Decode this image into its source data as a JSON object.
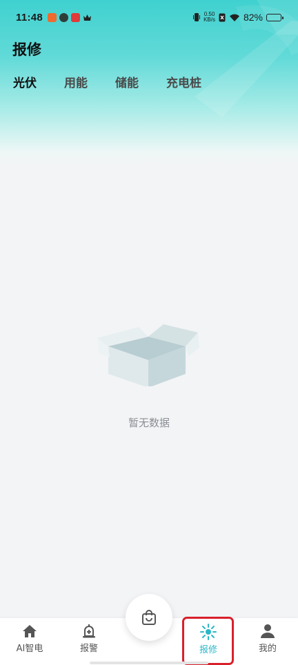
{
  "status_bar": {
    "time": "11:48",
    "net_speed_value": "0.50",
    "net_speed_unit": "KB/s",
    "battery_percent": "82%",
    "battery_level": 0.82
  },
  "page": {
    "title": "报修"
  },
  "tabs": [
    {
      "label": "光伏",
      "active": true
    },
    {
      "label": "用能",
      "active": false
    },
    {
      "label": "储能",
      "active": false
    },
    {
      "label": "充电桩",
      "active": false
    }
  ],
  "empty_state": {
    "text": "暂无数据",
    "icon": "empty-box-icon"
  },
  "bottom_nav": {
    "items": [
      {
        "label": "AI智电",
        "icon": "home-icon"
      },
      {
        "label": "报警",
        "icon": "alarm-bell-icon"
      },
      {
        "label": "报修",
        "icon": "repair-icon",
        "active": true
      },
      {
        "label": "我的",
        "icon": "user-icon"
      }
    ],
    "center_icon": "shopping-bag-icon"
  },
  "colors": {
    "accent": "#2bb7c7",
    "header_top": "#3fd1cf",
    "highlight": "#d9202b"
  }
}
